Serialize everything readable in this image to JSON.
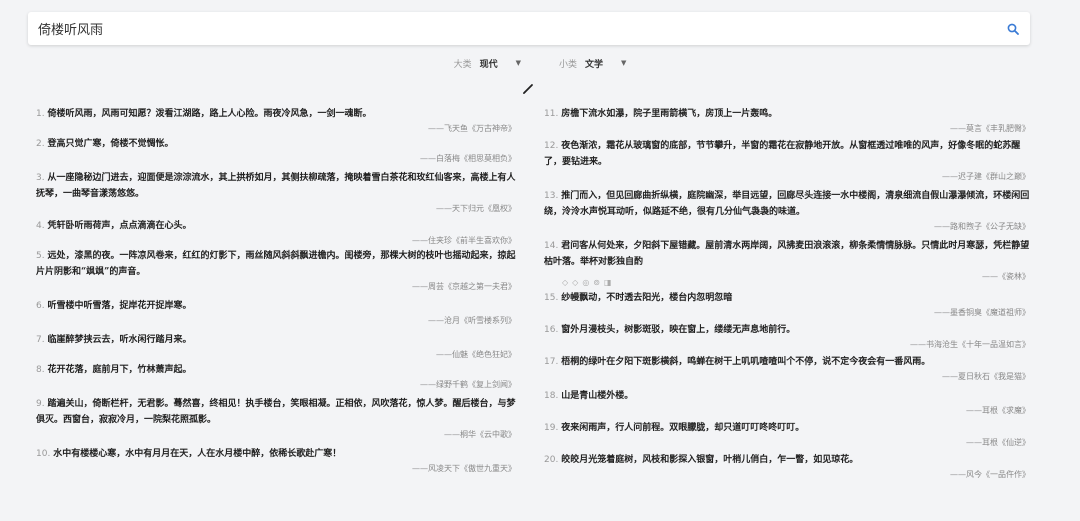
{
  "search": {
    "value": "倚楼听风雨"
  },
  "filters": [
    {
      "label": "大类",
      "value": "现代"
    },
    {
      "label": "小类",
      "value": "文学"
    }
  ],
  "left_poems": [
    {
      "num": "1.",
      "text": "倚楼听风雨，风雨可知愿？泼看江湖路，路上人心险。雨夜冷风急，一剑一魂断。",
      "src": "——飞天鱼《万古神帝》"
    },
    {
      "num": "2.",
      "text": "登高只觉广寒，倚楼不觉惆怅。",
      "src": "——白落梅《相思莫相负》"
    },
    {
      "num": "3.",
      "text": "从一座隐秘边门进去，迎面便是淙淙流水，其上拱桥如月，其侧扶柳疏落，掩映着雪白茶花和玫红仙客来，高楼上有人抚琴，一曲琴音漾荡悠悠。",
      "src": "——天下归元《凰权》"
    },
    {
      "num": "4.",
      "text": "凭轩卧听雨荷声，点点滴滴在心头。",
      "src": "——住夹珍《前半生喜欢你》"
    },
    {
      "num": "5.",
      "text": "远处，漆黑的夜。一阵凉风卷来，红红的灯影下，雨丝随风斜斜飘进檐内。闺楼旁，那棵大树的枝叶也摇动起来，掠起片片阴影和“飒飒”的声音。",
      "src": "——周芸《京越之第一夫君》"
    },
    {
      "num": "6.",
      "text": "听雪楼中听雪落，捉岸花开捉岸寒。",
      "src": "——沧月《听雪楼系列》"
    },
    {
      "num": "7.",
      "text": "临崖醉梦挟云去，听水闲行踏月来。",
      "src": "——仙魅《绝色狂妃》"
    },
    {
      "num": "8.",
      "text": "花开花落，庭前月下，竹林萧声起。",
      "src": "——绿野千鹤《复上剑闻》"
    },
    {
      "num": "9.",
      "text": "踏遍关山，倚断栏杆，无君影。蓦然喜，终相见！执手楼台，笑眼相凝。正相依，风吹落花，惊人梦。醒后楼台，与梦俱灭。西窗台，寂寂冷月，一院梨花照孤影。",
      "src": "——桐华《云中歌》"
    },
    {
      "num": "10.",
      "text": "水中有楼楼心寒，水中有月月在天，人在水月楼中醉，依稀长歌赴广寒！",
      "src": "——风凌天下《傲世九重天》"
    }
  ],
  "right_poems": [
    {
      "num": "11.",
      "text": "房檐下流水如瀑，院子里雨箭横飞，房顶上一片轰鸣。",
      "src": "——莫言《丰乳肥臀》"
    },
    {
      "num": "12.",
      "text": "夜色渐浓，霜花从玻璃窗的底部，节节攀升，半窗的霜花在寂静地开放。从窗框透过唯唯的风声，好像冬眠的蛇苏醒了，要钻进来。",
      "src": "——迟子建《群山之巅》"
    },
    {
      "num": "13.",
      "text": "推门而入，但见回廊曲折纵横，庭院幽深，举目远望，回廊尽头连接一水中楼阁，清泉细流自假山瀑瀑倾流，环楼闲回绕，泠泠水声悦耳动听，似路延不绝，很有几分仙气袅袅的味道。",
      "src": "——路和煦子《公子无缺》"
    },
    {
      "num": "14.",
      "text": "君问客从何处来，夕阳斜下屋错藏。屋前清水两岸阔，风拂麦田浪滚滚，柳条柔情情脉脉。只情此时月寒瑟，凭栏静望枯叶落。举杯对影独自酌",
      "src": "——《瓷林》"
    },
    {
      "num": "15.",
      "text": "纱幔飘动，不时透去阳光，楼台内忽明忽暗",
      "src": "——墨香铜臭《魔道祖师》"
    },
    {
      "num": "16.",
      "text": "窗外月漫枝头，树影斑驳，映在窗上，缕缕无声息地前行。",
      "src": "——书海沧生《十年一品温如言》"
    },
    {
      "num": "17.",
      "text": "梧桐的绿叶在夕阳下斑影横斜，鸣蝉在树干上叽叽喳喳叫个不停，说不定今夜会有一番风雨。",
      "src": "——夏日秋石《我是猫》"
    },
    {
      "num": "18.",
      "text": "山是青山楼外楼。",
      "src": "——耳根《求魔》"
    },
    {
      "num": "19.",
      "text": "夜来闲雨声，行人问前程。双眼朦胧，却只道叮叮咚咚叮叮。",
      "src": "——耳根《仙逆》"
    },
    {
      "num": "20.",
      "text": "皎皎月光笼着庭树，风枝和影探入银窗，叶梢儿俏白，乍一瞥，如见琼花。",
      "src": "——风今《一品仵作》"
    }
  ],
  "toolbar_icons": [
    "thumbs-up-icon",
    "thumbs-down-icon",
    "collect-icon",
    "copy-icon",
    "share-icon"
  ]
}
